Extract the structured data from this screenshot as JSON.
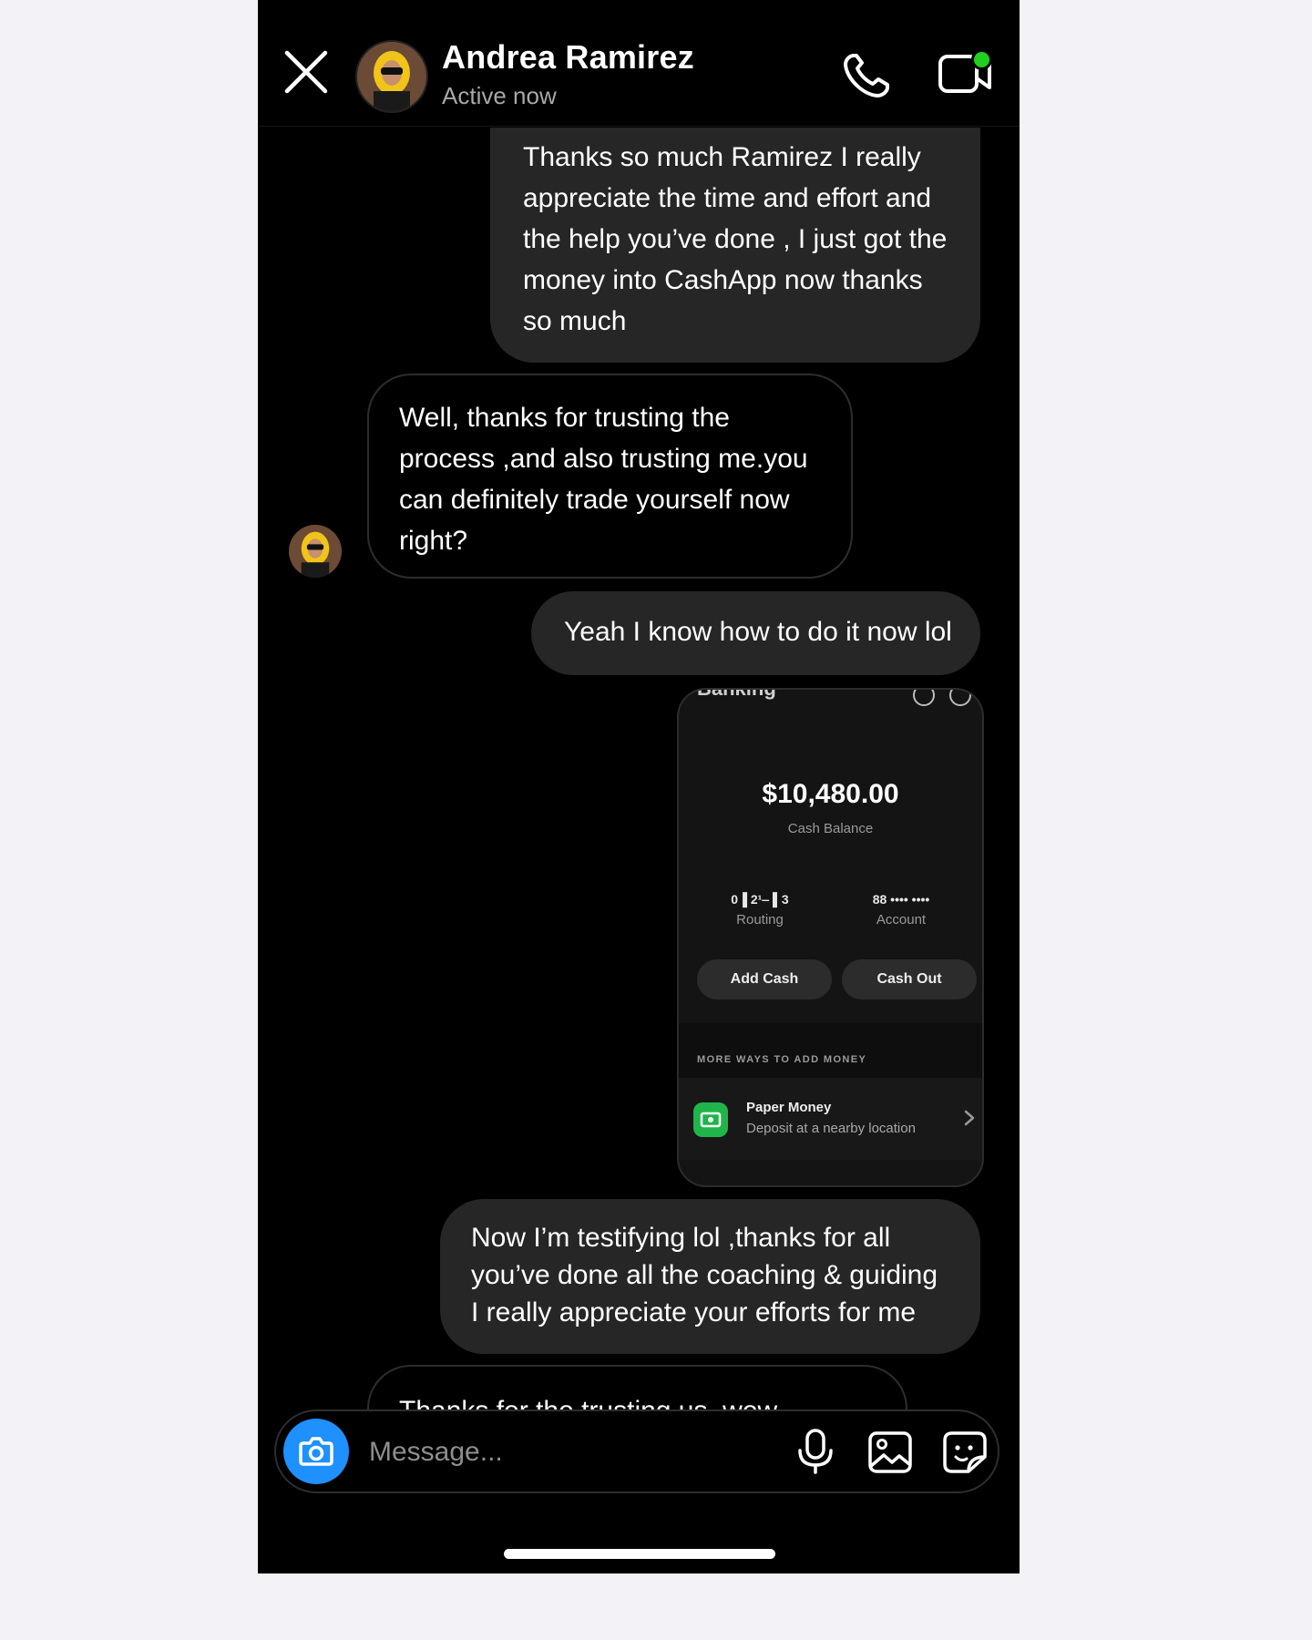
{
  "header": {
    "name": "Andrea Ramirez",
    "status": "Active now"
  },
  "messages": [
    {
      "direction": "sent",
      "lines": [
        "Thanks so much Ramirez I really",
        "appreciate the time and effort and",
        "the help you’ve done , I just got the",
        "money into CashApp now thanks",
        "so much"
      ]
    },
    {
      "direction": "received",
      "lines": [
        "Well, thanks for trusting the",
        "process ,and also trusting me.you",
        "can definitely trade yourself now",
        "right?"
      ]
    },
    {
      "direction": "sent",
      "lines": [
        "Yeah I know how to do it now lol"
      ]
    },
    {
      "direction": "sent",
      "lines": [
        "Now I’m testifying lol ,thanks for all",
        "you’ve done all the coaching & guiding",
        "I really appreciate your efforts for me"
      ]
    },
    {
      "direction": "received",
      "lines": [
        "Thanks for the trusting us, wow"
      ]
    }
  ],
  "shared_card": {
    "title": "Banking",
    "balance": "$10,480.00",
    "balance_label": "Cash Balance",
    "routing_value": "0▐ 2¹‒ ▌3",
    "routing_label": "Routing",
    "account_value": "88 •••• ••••",
    "account_label": "Account",
    "add_cash": "Add Cash",
    "cash_out": "Cash Out",
    "section_label": "MORE WAYS TO ADD MONEY",
    "paper_title": "Paper Money",
    "paper_subtitle": "Deposit at a nearby location"
  },
  "composer": {
    "placeholder": "Message..."
  },
  "colors": {
    "background": "#000000",
    "sent_bubble": "#262626",
    "camera_button": "#1e90ff",
    "online_dot": "#20d020",
    "cash_green": "#1fb54a"
  },
  "icons": [
    "close-icon",
    "phone-icon",
    "video-camera-icon",
    "camera-icon",
    "microphone-icon",
    "gallery-icon",
    "sticker-icon",
    "chevron-right-icon"
  ]
}
